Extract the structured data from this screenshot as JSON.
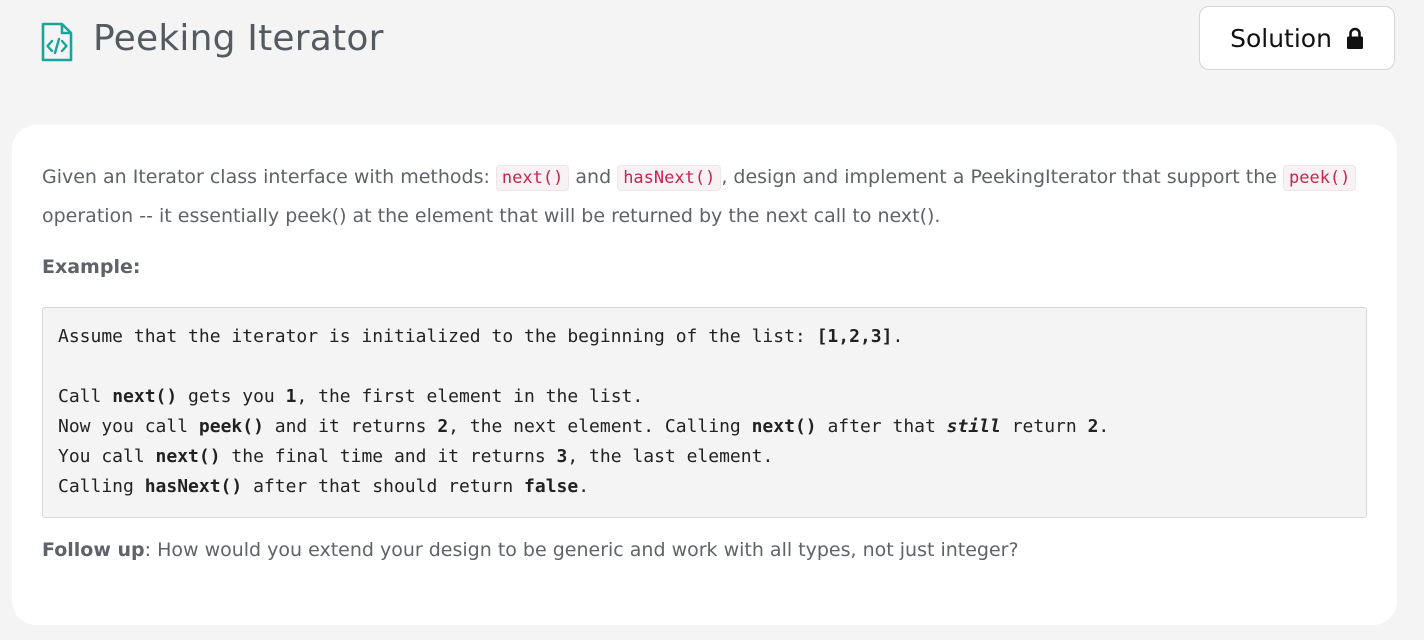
{
  "header": {
    "title": "Peeking Iterator",
    "icon": "code-file-icon",
    "solution_button": {
      "label": "Solution",
      "icon": "lock-icon"
    }
  },
  "colors": {
    "accent": "#1aa59b",
    "inline_code": "#c7254e",
    "inline_code_bg": "#f9f2f4",
    "page_bg": "#f4f4f4",
    "card_bg": "#ffffff",
    "text": "#5f6368"
  },
  "description": {
    "t1": "Given an Iterator class interface with methods:",
    "code1": "next()",
    "t2": "and",
    "code2": "hasNext()",
    "t3": ", design and implement a PeekingIterator that support the",
    "code3": "peek()",
    "t4": "operation -- it essentially peek() at the element that will be returned by the next call to next()."
  },
  "example": {
    "label": "Example:",
    "lines": [
      [
        {
          "text": "Assume that the iterator is initialized to the beginning of the list: "
        },
        {
          "text": "[1,2,3]",
          "b": true
        },
        {
          "text": "."
        }
      ],
      [],
      [
        {
          "text": "Call "
        },
        {
          "text": "next()",
          "b": true
        },
        {
          "text": " gets you "
        },
        {
          "text": "1",
          "b": true
        },
        {
          "text": ", the first element in the list."
        }
      ],
      [
        {
          "text": "Now you call "
        },
        {
          "text": "peek()",
          "b": true
        },
        {
          "text": " and it returns "
        },
        {
          "text": "2",
          "b": true
        },
        {
          "text": ", the next element. Calling "
        },
        {
          "text": "next()",
          "b": true
        },
        {
          "text": " after that "
        },
        {
          "text": "still",
          "i": true
        },
        {
          "text": " return "
        },
        {
          "text": "2",
          "b": true
        },
        {
          "text": "."
        }
      ],
      [
        {
          "text": "You call "
        },
        {
          "text": "next()",
          "b": true
        },
        {
          "text": " the final time and it returns "
        },
        {
          "text": "3",
          "b": true
        },
        {
          "text": ", the last element."
        }
      ],
      [
        {
          "text": "Calling "
        },
        {
          "text": "hasNext()",
          "b": true
        },
        {
          "text": " after that should return "
        },
        {
          "text": "false",
          "b": true
        },
        {
          "text": "."
        }
      ]
    ]
  },
  "follow_up": {
    "label": "Follow up",
    "text": ": How would you extend your design to be generic and work with all types, not just integer?"
  }
}
